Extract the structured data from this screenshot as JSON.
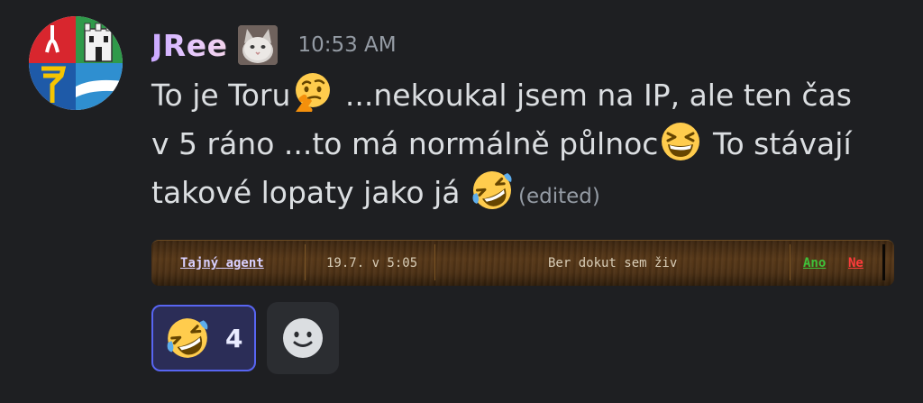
{
  "message": {
    "username": "JRee",
    "timestamp": "10:53 AM",
    "text": {
      "part1": "To je Toru",
      "part2": " ...nekoukal jsem na IP, ale ten čas v 5 ráno ...to má normálně půlnoc",
      "part3": " To stávají takové lopaty jako já ",
      "edited": "(edited)"
    },
    "emojis": [
      "thinking-face",
      "grinning-squinting-face",
      "rolling-on-floor-laughing"
    ]
  },
  "embed": {
    "agent": "Tajný agent",
    "time": "19.7. v 5:05",
    "text": "Ber dokut sem živ",
    "yes": "Ano",
    "no": "Ne"
  },
  "reactions": [
    {
      "emoji": "rolling-on-floor-laughing",
      "count": "4"
    }
  ],
  "add_reaction_icon": "smile-add-reaction-icon",
  "colors": {
    "background": "#1e1f22",
    "text": "#dbdee1",
    "muted": "#949ba4",
    "reaction_active_border": "#5865f2",
    "reaction_active_bg": "#2b2d57",
    "yes": "#3ec23a",
    "no": "#ff3b3b"
  }
}
